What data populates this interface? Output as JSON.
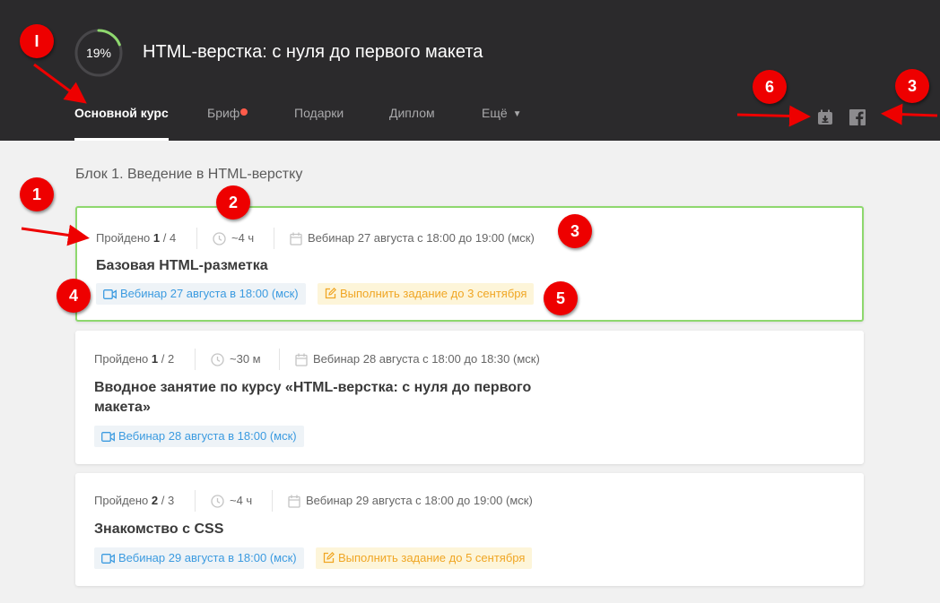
{
  "header": {
    "progress_text": "19%",
    "progress": 0.19,
    "course_title": "HTML-верстка: с нуля до первого макета",
    "tabs": [
      {
        "label": "Основной курс"
      },
      {
        "label": "Бриф"
      },
      {
        "label": "Подарки"
      },
      {
        "label": "Диплом"
      },
      {
        "label": "Ещё"
      }
    ],
    "icons": [
      "calendar-download-icon",
      "facebook-icon"
    ]
  },
  "block_title": "Блок 1. Введение в HTML-верстку",
  "lessons": [
    {
      "passed_label": "Пройдено",
      "passed_done": "1",
      "passed_total": "/ 4",
      "duration": "~4 ч",
      "schedule": "Вебинар 27 августа с 18:00 до 19:00 (мск)",
      "title": "Базовая HTML-разметка",
      "webinar": "Вебинар 27 августа в 18:00 (мск)",
      "task": "Выполнить задание до 3 сентября"
    },
    {
      "passed_label": "Пройдено",
      "passed_done": "1",
      "passed_total": "/ 2",
      "duration": "~30 м",
      "schedule": "Вебинар 28 августа с 18:00 до 18:30 (мск)",
      "title_line1": "Вводное занятие по курсу «HTML-верстка: с нуля до первого",
      "title_line2": "макета»",
      "webinar": "Вебинар 28 августа в 18:00 (мск)"
    },
    {
      "passed_label": "Пройдено",
      "passed_done": "2",
      "passed_total": "/ 3",
      "duration": "~4 ч",
      "schedule": "Вебинар 29 августа с 18:00 до 19:00 (мск)",
      "title": "Знакомство с CSS",
      "webinar": "Вебинар 29 августа в 18:00 (мск)",
      "task": "Выполнить задание до 5 сентября"
    }
  ],
  "annotations": [
    "I",
    "1",
    "2",
    "3",
    "4",
    "5",
    "6",
    "3"
  ],
  "colors": {
    "header_bg": "#2b2a2c",
    "accent_green": "#8ed86e",
    "webinar_blue": "#3c9be0",
    "task_orange": "#f0a624",
    "marker_red": "#ee0000"
  }
}
